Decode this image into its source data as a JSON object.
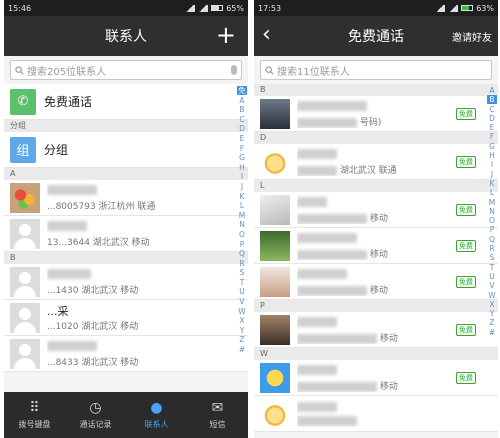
{
  "left": {
    "status": {
      "time": "15:46",
      "battery": "65%"
    },
    "nav": {
      "title": "联系人",
      "add_icon": "plus-icon"
    },
    "search": {
      "placeholder": "搜索205位联系人"
    },
    "features": [
      {
        "label": "免费通话",
        "icon": "phone-icon"
      }
    ],
    "group_section": "分组",
    "group": {
      "label": "分组",
      "icon_char": "组"
    },
    "sections": [
      {
        "letter": "A",
        "contacts": [
          {
            "name": "",
            "detail": "...8005793 浙江杭州 联通"
          },
          {
            "name": "",
            "detail": "13...3644 湖北武汉 移动"
          }
        ]
      },
      {
        "letter": "B",
        "contacts": [
          {
            "name": "",
            "detail": "...1430 湖北武汉 移动"
          },
          {
            "name": "...采",
            "detail": "...1020 湖北武汉 移动"
          },
          {
            "name": "",
            "detail": "...8433 湖北武汉 移动"
          }
        ]
      }
    ],
    "index": [
      "免",
      "A",
      "B",
      "C",
      "D",
      "E",
      "F",
      "G",
      "H",
      "I",
      "J",
      "K",
      "L",
      "M",
      "N",
      "O",
      "P",
      "Q",
      "R",
      "S",
      "T",
      "U",
      "V",
      "W",
      "X",
      "Y",
      "Z",
      "#"
    ],
    "tabs": [
      {
        "label": "拨号键盘",
        "icon": "dialpad-icon",
        "glyph": "⠿",
        "active": false
      },
      {
        "label": "通话记录",
        "icon": "clock-icon",
        "glyph": "◷",
        "active": false
      },
      {
        "label": "联系人",
        "icon": "person-icon",
        "glyph": "●",
        "active": true
      },
      {
        "label": "短信",
        "icon": "chat-icon",
        "glyph": "✉",
        "active": false
      }
    ]
  },
  "right": {
    "status": {
      "time": "17:53",
      "battery": "63%"
    },
    "nav": {
      "title": "免费通话",
      "back_icon": "back-arrow-icon",
      "invite": "邀请好友"
    },
    "search": {
      "placeholder": "搜索11位联系人"
    },
    "badge": "免费",
    "sections": [
      {
        "letter": "B",
        "contacts": [
          {
            "detail": "号码)"
          }
        ]
      },
      {
        "letter": "D",
        "contacts": [
          {
            "detail": "湖北武汉 联通"
          }
        ]
      },
      {
        "letter": "L",
        "contacts": [
          {
            "detail": "移动"
          },
          {
            "detail": "移动"
          }
        ]
      },
      {
        "letter": "",
        "contacts": [
          {
            "detail": "移动"
          }
        ]
      },
      {
        "letter": "P",
        "contacts": [
          {
            "detail": "移动"
          }
        ]
      },
      {
        "letter": "W",
        "contacts": [
          {
            "detail": "移动"
          },
          {
            "detail": ""
          }
        ]
      }
    ],
    "index": [
      "A",
      "B",
      "C",
      "D",
      "E",
      "F",
      "G",
      "H",
      "I",
      "J",
      "K",
      "L",
      "M",
      "N",
      "O",
      "P",
      "Q",
      "R",
      "S",
      "T",
      "U",
      "V",
      "W",
      "X",
      "Y",
      "Z",
      "#"
    ],
    "index_selected": "B"
  }
}
